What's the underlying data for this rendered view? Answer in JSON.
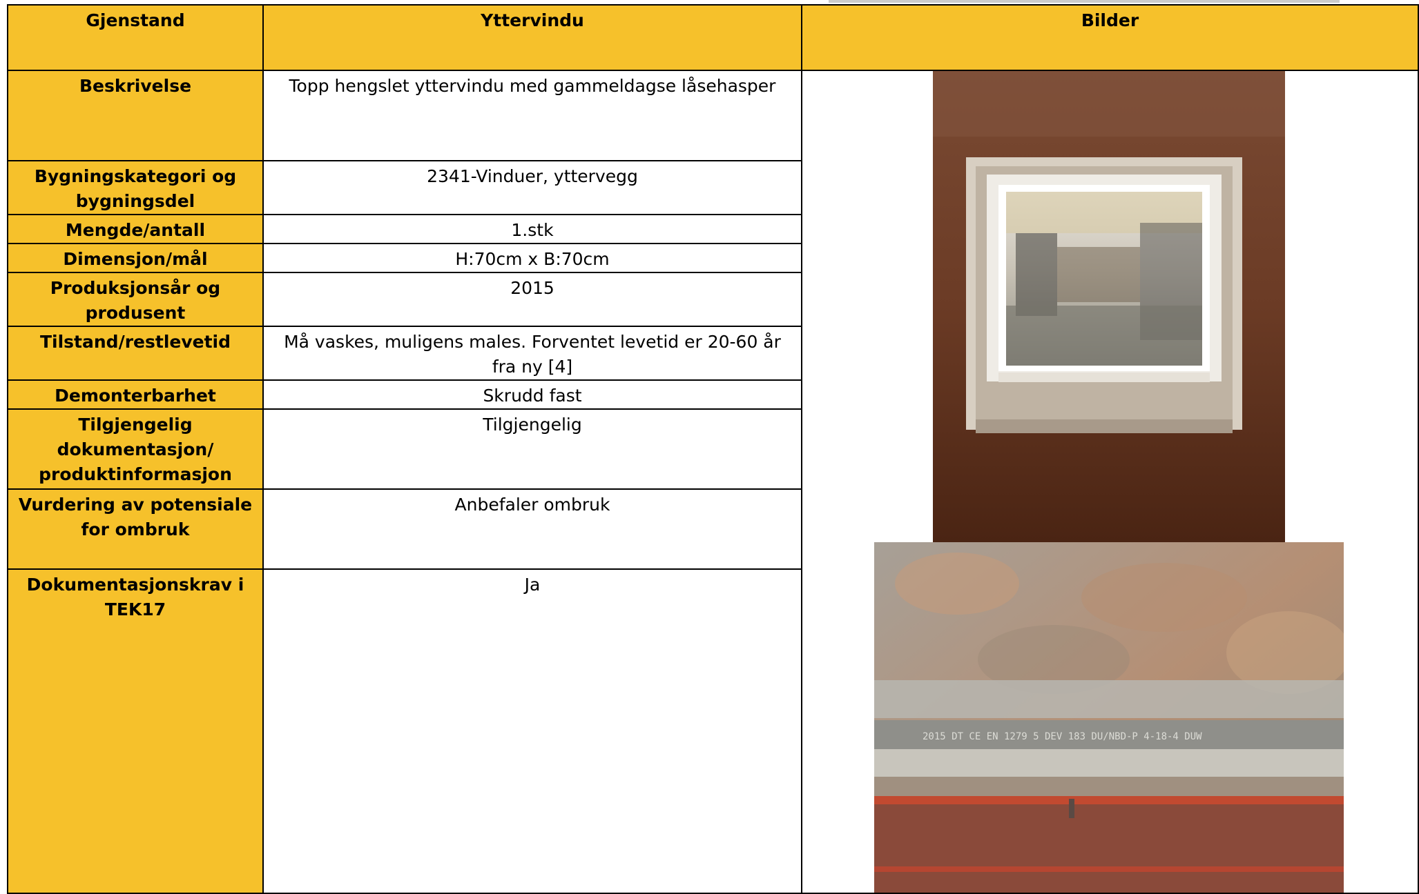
{
  "header": {
    "col1": "Gjenstand",
    "col2": "Yttervindu",
    "col3": "Bilder"
  },
  "rows": {
    "beskrivelse": {
      "label": "Beskrivelse",
      "value": "Topp hengslet yttervindu med gammeldagse låsehasper"
    },
    "bygningskategori": {
      "label": "Bygningskategori og bygningsdel",
      "value": "2341-Vinduer, yttervegg"
    },
    "mengde": {
      "label": "Mengde/antall",
      "value": "1.stk"
    },
    "dimensjon": {
      "label": "Dimensjon/mål",
      "value": "H:70cm x B:70cm"
    },
    "produksjon": {
      "label": "Produksjonsår og produsent",
      "value": "2015"
    },
    "tilstand": {
      "label": "Tilstand/restlevetid",
      "value": "Må vaskes, muligens males. Forventet levetid er 20-60 år fra ny [4]"
    },
    "demonterbarhet": {
      "label": "Demonterbarhet",
      "value": "Skrudd fast"
    },
    "dokumentasjon": {
      "label": "Tilgjengelig dokumentasjon/ produktinformasjon",
      "value": "Tilgjengelig"
    },
    "vurdering": {
      "label": "Vurdering av potensiale for ombruk",
      "value": "Anbefaler ombruk"
    },
    "tek17": {
      "label": "Dokumentasjonskrav i TEK17",
      "value": "Ja"
    }
  },
  "photo_texts": {
    "glass_marking": "2015 DT CE EN 1279 5 DEV 183 DU/NBD-P 4-18-4 DUW"
  },
  "colors": {
    "header_bg": "#F6C12B",
    "border": "#000000"
  }
}
